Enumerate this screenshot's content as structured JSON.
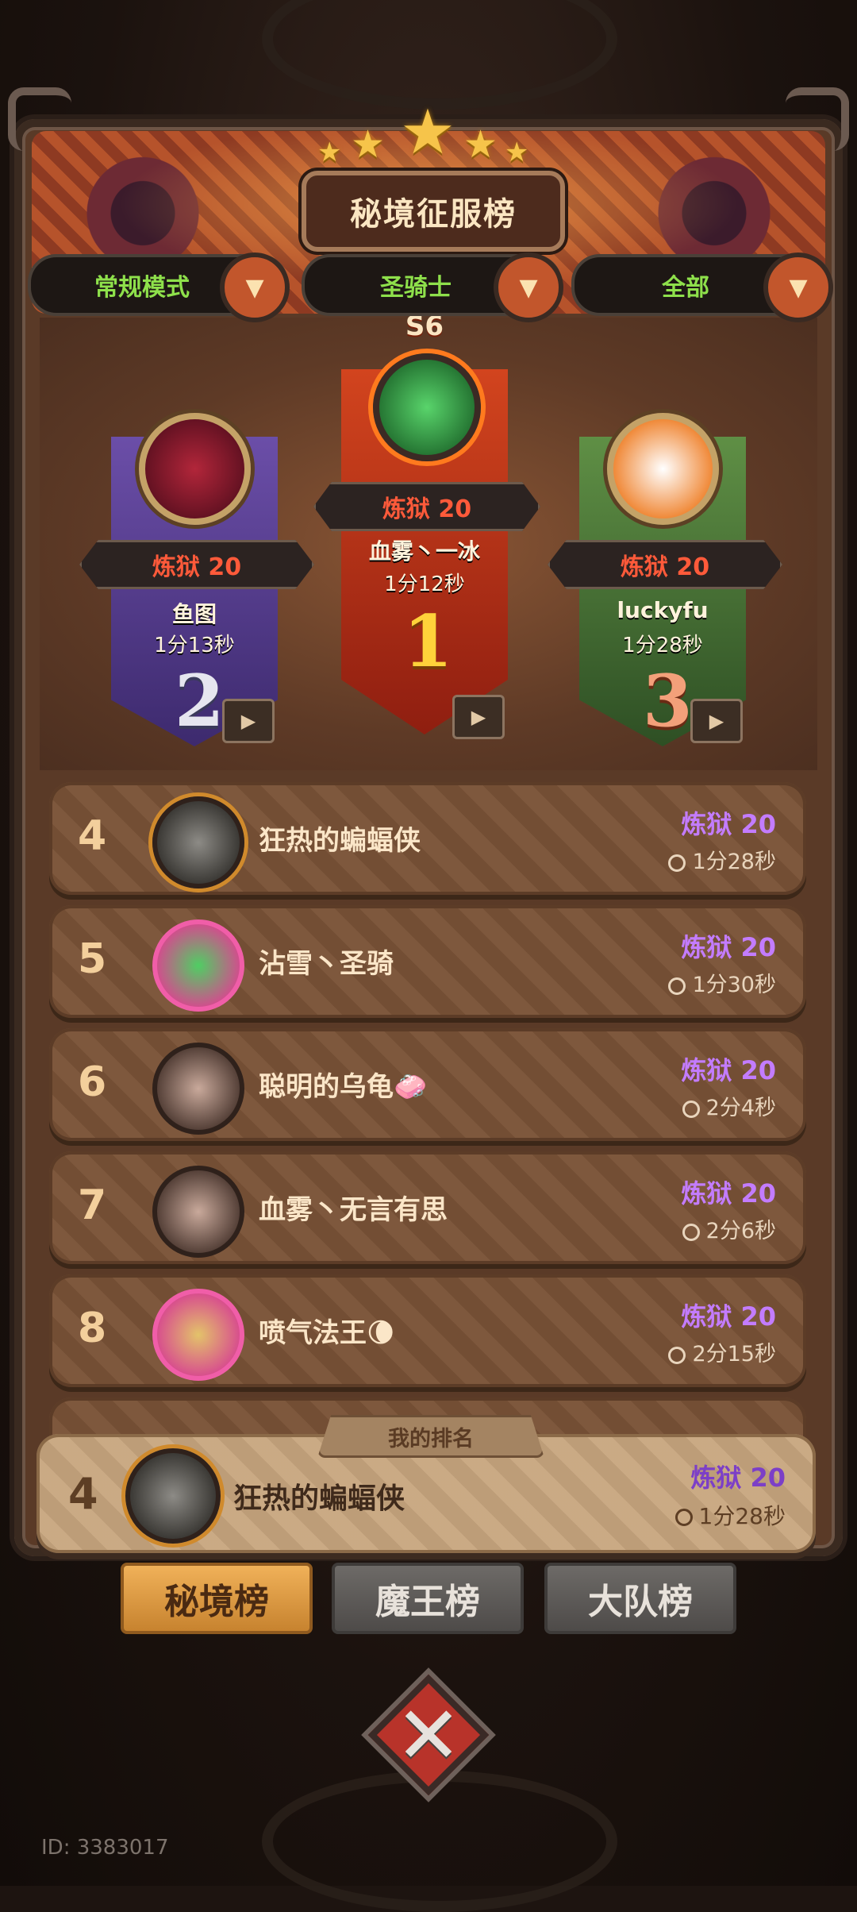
{
  "header": {
    "title": "秘境征服榜"
  },
  "filters": [
    {
      "label": "常规模式"
    },
    {
      "label": "圣骑士"
    },
    {
      "label": "全部"
    }
  ],
  "season": "S6",
  "podium": {
    "first": {
      "rank": "1",
      "level": "炼狱 20",
      "name": "血雾丶一冰",
      "time": "1分12秒"
    },
    "second": {
      "rank": "2",
      "level": "炼狱 20",
      "name": "鱼图",
      "time": "1分13秒"
    },
    "third": {
      "rank": "3",
      "level": "炼狱 20",
      "name": "luckyfu",
      "time": "1分28秒"
    }
  },
  "leaderboard": [
    {
      "rank": "4",
      "name": "狂热的蝙蝠侠",
      "level": "炼狱 20",
      "time": "1分28秒"
    },
    {
      "rank": "5",
      "name": "沾雪丶圣骑",
      "level": "炼狱 20",
      "time": "1分30秒"
    },
    {
      "rank": "6",
      "name": "聪明的乌龟🧼",
      "level": "炼狱 20",
      "time": "2分4秒"
    },
    {
      "rank": "7",
      "name": "血雾丶无言有思",
      "level": "炼狱 20",
      "time": "2分6秒"
    },
    {
      "rank": "8",
      "name": "喷气法王🌘",
      "level": "炼狱 20",
      "time": "2分15秒"
    }
  ],
  "my_rank": {
    "tag": "我的排名",
    "rank": "4",
    "name": "狂热的蝙蝠侠",
    "level": "炼狱 20",
    "time": "1分28秒"
  },
  "tabs": [
    {
      "label": "秘境榜",
      "active": true
    },
    {
      "label": "魔王榜",
      "active": false
    },
    {
      "label": "大队榜",
      "active": false
    }
  ],
  "footer": {
    "uid": "ID: 3383017"
  },
  "icons": {
    "filter_dropdown": "chevron-down-icon",
    "video": "video-replay-icon",
    "clock": "clock-icon",
    "close": "close-icon"
  },
  "colors": {
    "level_text": "#c37cff",
    "filter_text": "#8ee04b",
    "podium_level": "#ff5a3a",
    "active_tab": "#e0a04a"
  }
}
